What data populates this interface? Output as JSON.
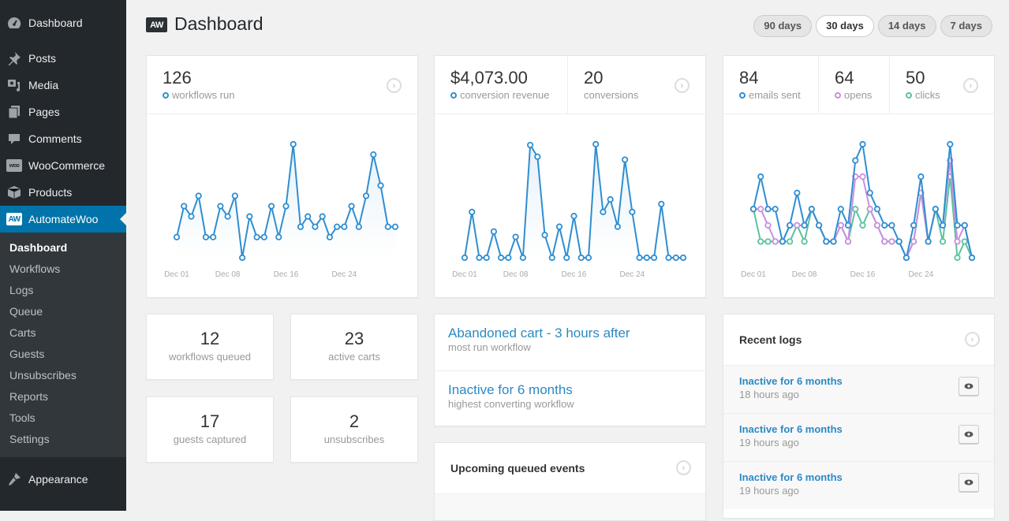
{
  "sidebar": {
    "items": [
      {
        "label": "Dashboard",
        "icon": "dashboard-icon"
      },
      {
        "label": "Posts",
        "icon": "pin-icon"
      },
      {
        "label": "Media",
        "icon": "media-icon"
      },
      {
        "label": "Pages",
        "icon": "pages-icon"
      },
      {
        "label": "Comments",
        "icon": "comment-icon"
      },
      {
        "label": "WooCommerce",
        "icon": "woo-icon"
      },
      {
        "label": "Products",
        "icon": "box-icon"
      },
      {
        "label": "AutomateWoo",
        "icon": "aw-icon"
      }
    ],
    "aw_logo_text": "AW",
    "woo_logo_text": "woo",
    "submenu": [
      "Dashboard",
      "Workflows",
      "Logs",
      "Queue",
      "Carts",
      "Guests",
      "Unsubscribes",
      "Reports",
      "Tools",
      "Settings"
    ],
    "appearance_label": "Appearance"
  },
  "header": {
    "logo_text": "AW",
    "title": "Dashboard",
    "ranges": [
      "90 days",
      "30 days",
      "14 days",
      "7 days"
    ],
    "active_range": "30 days"
  },
  "colors": {
    "accent": "#0073aa",
    "sent": "#2f8ed1",
    "opens": "#c98fe0",
    "clicks": "#5bc2a0",
    "link": "#2a8ac4"
  },
  "workflows_card": {
    "value": "126",
    "label": "workflows run"
  },
  "conversions_card": {
    "revenue_value": "$4,073.00",
    "revenue_label": "conversion revenue",
    "count_value": "20",
    "count_label": "conversions"
  },
  "email_card": {
    "sent_value": "84",
    "sent_label": "emails sent",
    "opens_value": "64",
    "opens_label": "opens",
    "clicks_value": "50",
    "clicks_label": "clicks"
  },
  "small_stats": [
    {
      "value": "12",
      "label": "workflows queued"
    },
    {
      "value": "23",
      "label": "active carts"
    },
    {
      "value": "17",
      "label": "guests captured"
    },
    {
      "value": "2",
      "label": "unsubscribes"
    }
  ],
  "workflow_highlights": [
    {
      "title": "Abandoned cart - 3 hours after",
      "subtitle": "most run workflow"
    },
    {
      "title": "Inactive for 6 months",
      "subtitle": "highest converting workflow"
    }
  ],
  "queued_panel": {
    "title": "Upcoming queued events"
  },
  "logs_panel": {
    "title": "Recent logs",
    "items": [
      {
        "title": "Inactive for 6 months",
        "time": "18 hours ago"
      },
      {
        "title": "Inactive for 6 months",
        "time": "19 hours ago"
      },
      {
        "title": "Inactive for 6 months",
        "time": "19 hours ago"
      }
    ]
  },
  "chart_data": [
    {
      "type": "line",
      "title": "workflows run",
      "x_ticks": [
        "Dec 01",
        "Dec 08",
        "Dec 16",
        "Dec 24"
      ],
      "x": "Dec 01 – Dec 31 (daily)",
      "series": [
        {
          "name": "workflows run",
          "color": "#2f8ed1",
          "values": [
            2,
            5,
            4,
            6,
            2,
            2,
            5,
            4,
            6,
            0,
            4,
            2,
            2,
            5,
            2,
            5,
            11,
            3,
            4,
            3,
            4,
            2,
            3,
            3,
            5,
            3,
            6,
            10,
            7,
            3,
            3
          ]
        }
      ],
      "ylim": [
        0,
        11
      ],
      "grid": false
    },
    {
      "type": "line",
      "title": "conversion revenue",
      "x_ticks": [
        "Dec 01",
        "Dec 08",
        "Dec 16",
        "Dec 24"
      ],
      "x": "Dec 01 – Dec 31 (daily)",
      "series": [
        {
          "name": "conversion revenue",
          "color": "#2f8ed1",
          "values": [
            0,
            220,
            0,
            0,
            126,
            0,
            0,
            100,
            0,
            541,
            485,
            109,
            0,
            149,
            0,
            200,
            0,
            0,
            545,
            220,
            280,
            149,
            471,
            220,
            0,
            0,
            0,
            258,
            0,
            0,
            0
          ]
        }
      ],
      "ylim": [
        0,
        545
      ],
      "grid": false
    },
    {
      "type": "line",
      "title": "emails",
      "x_ticks": [
        "Dec 01",
        "Dec 08",
        "Dec 16",
        "Dec 24"
      ],
      "x": "Dec 01 – Dec 31 (daily)",
      "series": [
        {
          "name": "emails sent",
          "color": "#2f8ed1",
          "values": [
            3,
            5,
            3,
            3,
            1,
            2,
            4,
            2,
            3,
            2,
            1,
            1,
            3,
            2,
            6,
            7,
            4,
            3,
            2,
            2,
            1,
            0,
            2,
            5,
            1,
            3,
            2,
            7,
            2,
            2,
            0
          ]
        },
        {
          "name": "opens",
          "color": "#c98fe0",
          "values": [
            3,
            3,
            2,
            1,
            1,
            2,
            2,
            2,
            3,
            2,
            1,
            1,
            2,
            1,
            5,
            5,
            3,
            2,
            1,
            1,
            1,
            0,
            1,
            4,
            1,
            3,
            2,
            6,
            1,
            2,
            0
          ]
        },
        {
          "name": "clicks",
          "color": "#5bc2a0",
          "values": [
            3,
            1,
            1,
            1,
            1,
            1,
            2,
            1,
            3,
            2,
            1,
            1,
            2,
            1,
            3,
            2,
            3,
            2,
            1,
            1,
            1,
            0,
            1,
            4,
            1,
            3,
            1,
            5,
            0,
            1,
            0
          ]
        }
      ],
      "ylim": [
        0,
        7
      ],
      "grid": false
    }
  ]
}
